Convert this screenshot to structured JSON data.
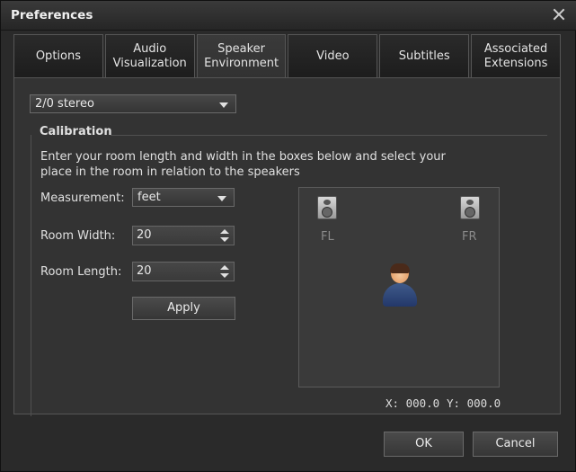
{
  "window": {
    "title": "Preferences"
  },
  "tabs": [
    {
      "label": "Options"
    },
    {
      "label": "Audio Visualization"
    },
    {
      "label": "Speaker Environment",
      "active": true
    },
    {
      "label": "Video"
    },
    {
      "label": "Subtitles"
    },
    {
      "label": "Associated Extensions"
    }
  ],
  "speaker_config": {
    "value": "2/0 stereo"
  },
  "calibration": {
    "title": "Calibration",
    "description": "Enter your room length and width in the boxes below and select your place in the room in relation to the speakers",
    "measurement_label": "Measurement:",
    "measurement_value": "feet",
    "room_width_label": "Room Width:",
    "room_width_value": "20",
    "room_length_label": "Room Length:",
    "room_length_value": "20",
    "apply_label": "Apply"
  },
  "room": {
    "speakers": [
      {
        "label": "FL"
      },
      {
        "label": "FR"
      }
    ],
    "x_readout": "X: 000.0",
    "y_readout": "Y: 000.0"
  },
  "footer": {
    "ok_label": "OK",
    "cancel_label": "Cancel"
  }
}
